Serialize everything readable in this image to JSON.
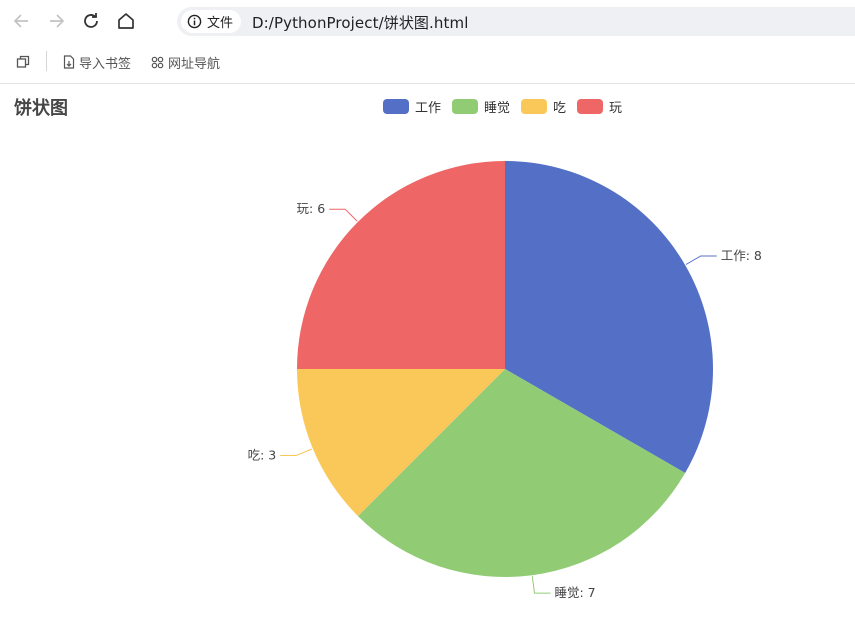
{
  "browser": {
    "address_label": "文件",
    "url": "D:/PythonProject/饼状图.html",
    "icons": [
      "back-arrow-icon",
      "forward-arrow-icon",
      "reload-icon",
      "home-icon",
      "info-icon"
    ]
  },
  "bookmarks": {
    "items": [
      {
        "label": "导入书签",
        "icon": "import-bookmark-icon"
      },
      {
        "label": "网址导航",
        "icon": "grid-icon"
      }
    ]
  },
  "page": {
    "title": "饼状图"
  },
  "chart_data": {
    "type": "pie",
    "title": "饼状图",
    "legend_position": "top-center",
    "categories": [
      "工作",
      "睡觉",
      "吃",
      "玩"
    ],
    "values": [
      8,
      7,
      3,
      6
    ],
    "colors": [
      "#5470c6",
      "#91cc75",
      "#fac858",
      "#ee6666"
    ],
    "data_labels": [
      "工作: 8",
      "睡觉: 7",
      "吃: 3",
      "玩: 6"
    ]
  }
}
